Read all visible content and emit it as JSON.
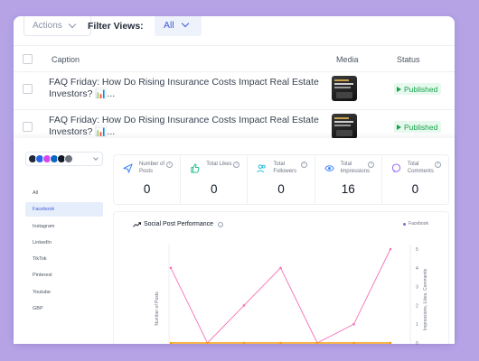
{
  "toolbar": {
    "actions_label": "Actions",
    "filter_label": "Filter Views:",
    "filter_value": "All"
  },
  "table": {
    "columns": {
      "caption": "Caption",
      "media": "Media",
      "status": "Status"
    },
    "rows": [
      {
        "caption": "FAQ Friday: How Do Rising Insurance Costs Impact Real Estate Investors? 📊...",
        "status": "Published"
      },
      {
        "caption": "FAQ Friday: How Do Rising Insurance Costs Impact Real Estate Investors? 📊...",
        "status": "Published"
      }
    ]
  },
  "analytics": {
    "platforms": [
      "All",
      "Facebook",
      "Instagram",
      "LinkedIn",
      "TikTok",
      "Pinterest",
      "Youtube",
      "GBP"
    ],
    "active_platform": "Facebook",
    "stats": [
      {
        "label": "Number of Posts",
        "value": "0",
        "icon": "send-icon",
        "color": "#3b82f6"
      },
      {
        "label": "Total Likes",
        "value": "0",
        "icon": "thumbs-up-icon",
        "color": "#10b981"
      },
      {
        "label": "Total Followers",
        "value": "0",
        "icon": "users-icon",
        "color": "#06b6d4"
      },
      {
        "label": "Total Impressions",
        "value": "16",
        "icon": "eye-icon",
        "color": "#3b82f6"
      },
      {
        "label": "Total Comments",
        "value": "0",
        "icon": "comment-icon",
        "color": "#8b5cf6"
      }
    ],
    "chart_title": "Social Post Performance",
    "legend_label": "Facebook"
  },
  "chart_data": {
    "type": "line",
    "title": "Social Post Performance",
    "ylabel": "Number of Posts",
    "y2label": "Impressions, Likes, Comments",
    "ylim": [
      0,
      5
    ],
    "y2lim": [
      0,
      5
    ],
    "y2ticks": [
      "5",
      "4",
      "3",
      "2",
      "1",
      "0"
    ],
    "legend": "top-right",
    "series": [
      {
        "name": "Facebook",
        "axis": "right",
        "color": "#f472b6",
        "values": [
          4,
          0,
          2,
          4,
          0,
          1,
          5
        ]
      },
      {
        "axis": "left",
        "color": "#f59e0b",
        "values": [
          0,
          0,
          0,
          0,
          0,
          0,
          0
        ]
      }
    ]
  }
}
